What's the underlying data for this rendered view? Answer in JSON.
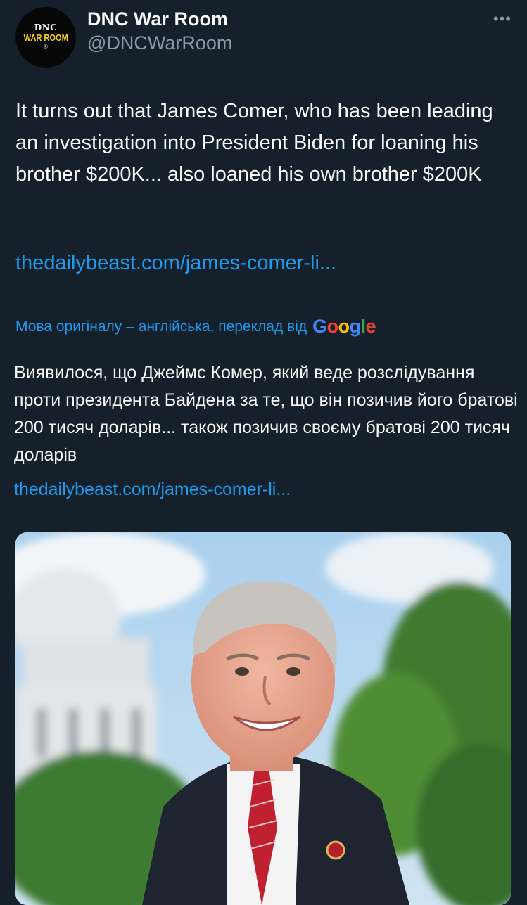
{
  "author": {
    "avatar_line1": "DNC",
    "avatar_line2": "WAR ROOM",
    "avatar_mark": "®",
    "name": "DNC War Room",
    "handle": "@DNCWarRoom"
  },
  "menu_icon": "more-horizontal-icon",
  "tweet": {
    "text": "It turns out that James Comer, who has been leading an investigation into President Biden for loaning his brother $200K... also loaned his own brother $200K",
    "link": "thedailybeast.com/james-comer-li..."
  },
  "translation": {
    "note": "Мова оригіналу – англійська, переклад від",
    "provider": [
      "G",
      "o",
      "o",
      "g",
      "l",
      "e"
    ],
    "provider_colors": [
      "#4285f4",
      "#ea4335",
      "#fbbc05",
      "#4285f4",
      "#34a853",
      "#ea4335"
    ],
    "text": "Виявилося, що Джеймс Комер, який веде розслідування проти президента Байдена за те, що він позичив його братові 200 тисяч доларів... також позичив своєму братові 200 тисяч доларів",
    "link": "thedailybeast.com/james-comer-li..."
  },
  "colors": {
    "background": "#15202b",
    "link": "#1d9bf0",
    "secondary_text": "#8b98a5"
  }
}
